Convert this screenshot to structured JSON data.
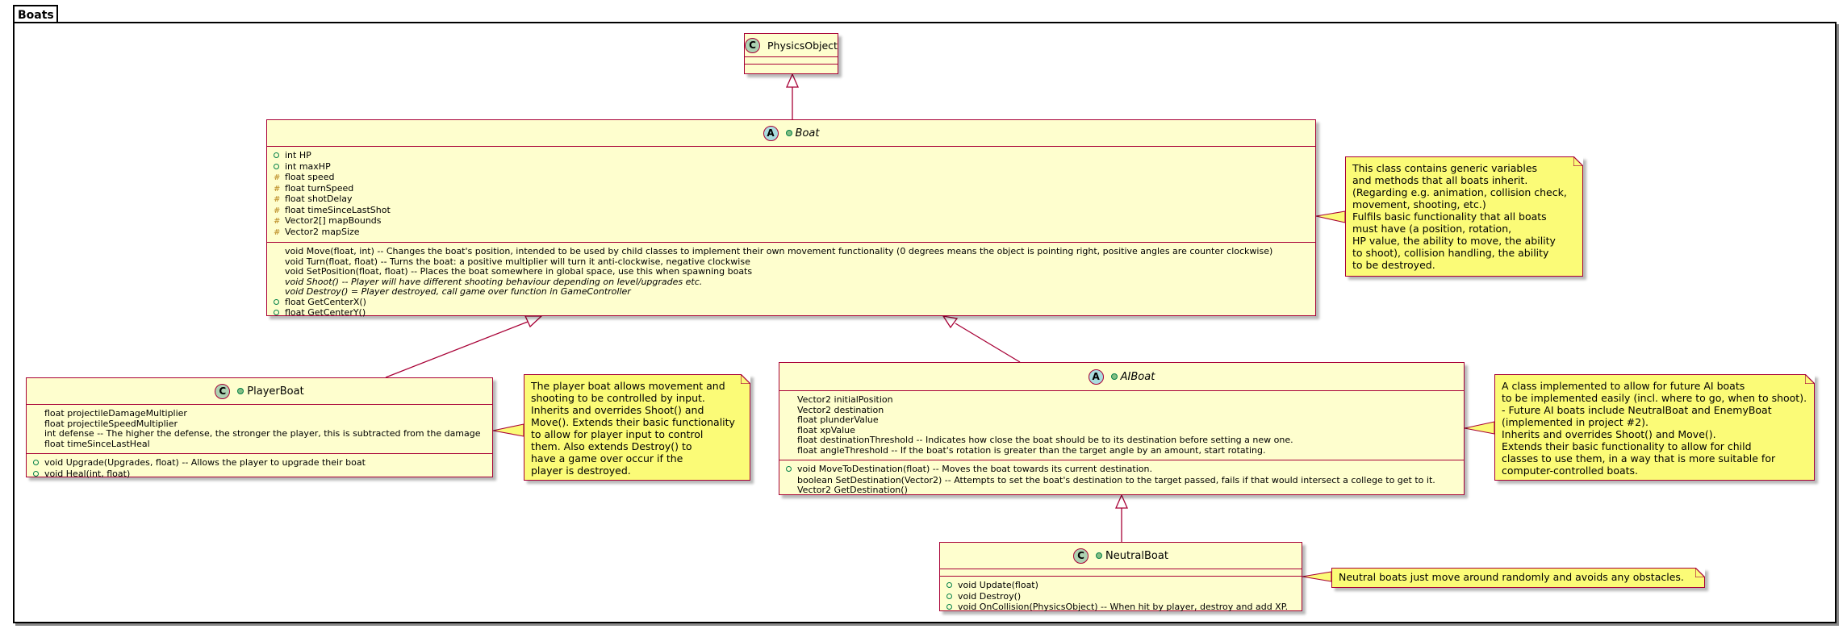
{
  "package": {
    "name": "Boats"
  },
  "classes": {
    "physics_object": {
      "badge": "C",
      "name": "PhysicsObject"
    },
    "boat": {
      "badge": "A",
      "name": "Boat",
      "fields": [
        {
          "vis": "public",
          "text": "int HP"
        },
        {
          "vis": "public",
          "text": "int maxHP"
        },
        {
          "vis": "protected",
          "text": "float speed"
        },
        {
          "vis": "protected",
          "text": "float turnSpeed"
        },
        {
          "vis": "protected",
          "text": "float shotDelay"
        },
        {
          "vis": "protected",
          "text": "float timeSinceLastShot"
        },
        {
          "vis": "protected",
          "text": "Vector2[] mapBounds"
        },
        {
          "vis": "protected",
          "text": "Vector2 mapSize"
        }
      ],
      "methods": [
        {
          "vis": "none",
          "text": "void Move(float, int) -- Changes the boat's position, intended to be used by child classes to implement their own movement functionality (0 degrees means the object is pointing right, positive angles are counter clockwise)"
        },
        {
          "vis": "none",
          "text": "void Turn(float, float) -- Turns the boat: a positive multiplier will turn it anti-clockwise, negative clockwise"
        },
        {
          "vis": "none",
          "text": "void SetPosition(float, float) -- Places the boat somewhere in global space, use this when spawning boats"
        },
        {
          "vis": "none",
          "text": "void Shoot() -- Player will have different shooting behaviour depending on level/upgrades etc.",
          "italic": true
        },
        {
          "vis": "none",
          "text": "void Destroy() = Player destroyed, call game over function in GameController",
          "italic": true
        },
        {
          "vis": "public",
          "text": "float GetCenterX()"
        },
        {
          "vis": "public",
          "text": "float GetCenterY()"
        }
      ]
    },
    "player_boat": {
      "badge": "C",
      "name": "PlayerBoat",
      "fields": [
        {
          "vis": "none",
          "text": "float projectileDamageMultiplier"
        },
        {
          "vis": "none",
          "text": "float projectileSpeedMultiplier"
        },
        {
          "vis": "none",
          "text": "int defense -- The higher the defense, the stronger the player, this is subtracted from the damage"
        },
        {
          "vis": "none",
          "text": "float timeSinceLastHeal"
        }
      ],
      "methods": [
        {
          "vis": "public",
          "text": "void Upgrade(Upgrades, float) -- Allows the player to upgrade their boat"
        },
        {
          "vis": "public",
          "text": "void Heal(int, float)"
        }
      ]
    },
    "ai_boat": {
      "badge": "A",
      "name": "AIBoat",
      "fields": [
        {
          "vis": "none",
          "text": "Vector2 initialPosition"
        },
        {
          "vis": "none",
          "text": "Vector2 destination"
        },
        {
          "vis": "none",
          "text": "float plunderValue"
        },
        {
          "vis": "none",
          "text": "float xpValue"
        },
        {
          "vis": "none",
          "text": "float destinationThreshold -- Indicates how close the boat should be to its destination before setting a new one."
        },
        {
          "vis": "none",
          "text": "float angleThreshold -- If the boat's rotation is greater than the target angle by an amount, start rotating."
        }
      ],
      "methods": [
        {
          "vis": "public",
          "text": "void MoveToDestination(float) -- Moves the boat towards its current destination."
        },
        {
          "vis": "none",
          "text": "boolean SetDestination(Vector2) -- Attempts to set the boat's destination to the target passed, fails if that would intersect a college to get to it."
        },
        {
          "vis": "none",
          "text": "Vector2 GetDestination()"
        }
      ]
    },
    "neutral_boat": {
      "badge": "C",
      "name": "NeutralBoat",
      "methods": [
        {
          "vis": "public",
          "text": "void Update(float)"
        },
        {
          "vis": "public",
          "text": "void Destroy()"
        },
        {
          "vis": "public",
          "text": "void OnCollision(PhysicsObject) -- When hit by player, destroy and add XP."
        }
      ]
    }
  },
  "notes": {
    "boat": [
      "This class contains generic variables",
      "and methods that all boats inherit.",
      "(Regarding e.g. animation, collision check,",
      "movement, shooting, etc.)",
      "Fulfils basic functionality that all boats",
      "must have (a position, rotation,",
      "HP value, the ability to move, the ability",
      "to shoot), collision handling, the ability",
      "to be destroyed."
    ],
    "player_boat": [
      "The player boat allows movement and",
      "shooting to be controlled by input.",
      "Inherits and overrides Shoot() and",
      "Move(). Extends their basic functionality",
      "to allow for player input to control",
      "them. Also extends Destroy() to",
      "have a game over occur if the",
      "player is destroyed."
    ],
    "ai_boat": [
      "A class implemented to allow for future AI boats",
      "to be implemented easily (incl. where to go, when to shoot).",
      "- Future AI boats include NeutralBoat and EnemyBoat",
      "(implemented in project #2).",
      "Inherits and overrides Shoot() and Move().",
      "Extends their basic functionality to allow for child",
      "classes to use them, in a way that is more suitable for",
      "computer-controlled boats."
    ],
    "neutral_boat": [
      "Neutral boats just move around randomly and avoids any obstacles."
    ]
  },
  "colors": {
    "class_bg": "#fefece",
    "border": "#a80036",
    "note_bg": "#fbfb77",
    "badge_class": "#add1b2",
    "badge_abstract": "#a9dcdf"
  }
}
